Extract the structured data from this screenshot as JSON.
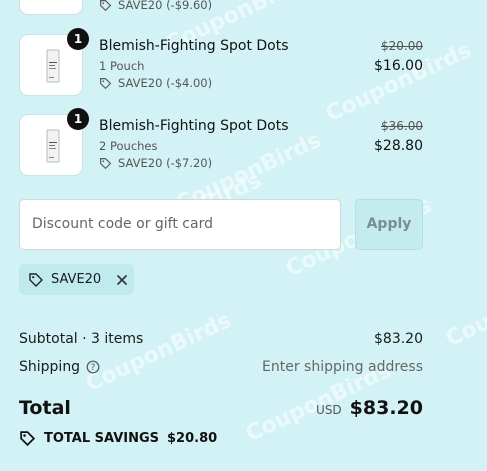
{
  "watermark": "CouponBirds",
  "items": [
    {
      "name": "",
      "variant": "",
      "quantity": "",
      "discount": "SAVE20 (-$9.60)",
      "original_price": "",
      "price": ""
    },
    {
      "name": "Blemish-Fighting Spot Dots",
      "variant": "1 Pouch",
      "quantity": "1",
      "discount": "SAVE20 (-$4.00)",
      "original_price": "$20.00",
      "price": "$16.00"
    },
    {
      "name": "Blemish-Fighting Spot Dots",
      "variant": "2 Pouches",
      "quantity": "1",
      "discount": "SAVE20 (-$7.20)",
      "original_price": "$36.00",
      "price": "$28.80"
    }
  ],
  "discount_form": {
    "placeholder": "Discount code or gift card",
    "apply_label": "Apply"
  },
  "applied_code": "SAVE20",
  "summary": {
    "subtotal_label": "Subtotal · 3 items",
    "subtotal_value": "$83.20",
    "shipping_label": "Shipping",
    "shipping_value": "Enter shipping address",
    "total_label": "Total",
    "currency": "USD",
    "total_value": "$83.20",
    "savings_label": "TOTAL SAVINGS",
    "savings_value": "$20.80"
  },
  "icons": {
    "tag": "tag-icon",
    "help": "help-circle-icon",
    "close": "close-icon"
  }
}
